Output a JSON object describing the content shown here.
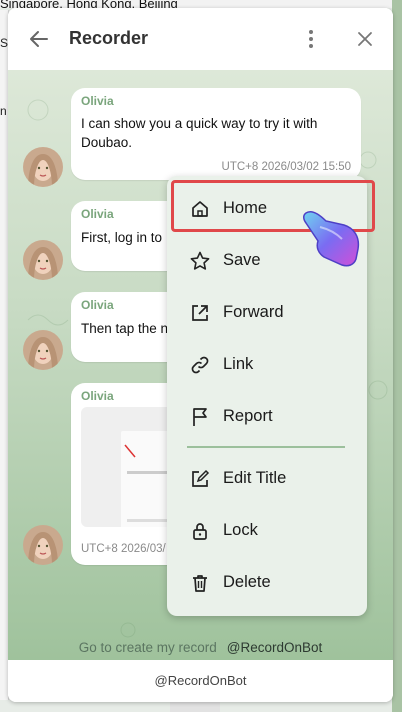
{
  "background": {
    "top_text": "Singapore, Hong Kong, Beijing",
    "side_chars": [
      "Si",
      "n"
    ]
  },
  "window": {
    "title": "Recorder"
  },
  "messages": [
    {
      "sender": "Olivia",
      "text_lines": [
        "I can show you a quick way to try it with",
        "Doubao."
      ],
      "time": "UTC+8 2026/03/02 15:50"
    },
    {
      "sender": "Olivia",
      "text_lines": [
        "First, log in to"
      ]
    },
    {
      "sender": "Olivia",
      "text_lines": [
        "Then tap the n"
      ]
    },
    {
      "sender": "Olivia",
      "image": true,
      "time": "UTC+8 2026/03/"
    }
  ],
  "menu": {
    "items": [
      {
        "label": "Home",
        "icon": "home-icon"
      },
      {
        "label": "Save",
        "icon": "star-icon"
      },
      {
        "label": "Forward",
        "icon": "share-icon"
      },
      {
        "label": "Link",
        "icon": "link-icon"
      },
      {
        "label": "Report",
        "icon": "flag-icon"
      },
      {
        "label": "Edit Title",
        "icon": "edit-icon"
      },
      {
        "label": "Lock",
        "icon": "lock-icon"
      },
      {
        "label": "Delete",
        "icon": "trash-icon"
      }
    ],
    "highlighted": "Home",
    "highlight_color": "#e0484a"
  },
  "footer": {
    "cta": "Go to create my record",
    "handle": "@RecordOnBot"
  },
  "bottom_bar": {
    "label": "@RecordOnBot"
  },
  "colors": {
    "sender": "#7aa57c",
    "menu_bg": "#eaf1ea"
  }
}
